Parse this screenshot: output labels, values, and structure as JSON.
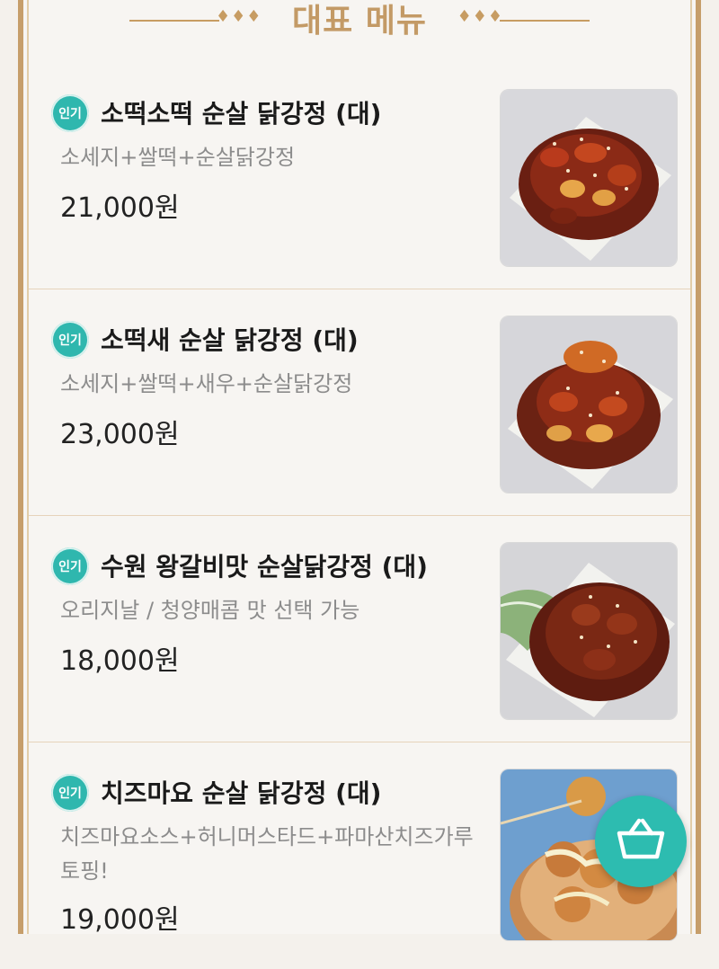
{
  "header": {
    "title": "대표 메뉴",
    "ornament": "♦♦♦"
  },
  "items": [
    {
      "badge": "인기",
      "name": "소떡소떡 순살 닭강정 (대)",
      "desc": "소세지+쌀떡+순살닭강정",
      "price": "21,000원",
      "image": "chicken-tteok-sausage"
    },
    {
      "badge": "인기",
      "name": "소떡새 순살 닭강정 (대)",
      "desc": "소세지+쌀떡+새우+순살닭강정",
      "price": "23,000원",
      "image": "chicken-shrimp-tteok"
    },
    {
      "badge": "인기",
      "name": "수원 왕갈비맛 순살닭강정 (대)",
      "desc": "오리지날 / 청양매콤 맛 선택 가능",
      "price": "18,000원",
      "image": "galbi-chicken"
    },
    {
      "badge": "인기",
      "name": "치즈마요 순살 닭강정 (대)",
      "desc": "치즈마요소스+허니머스타드+파마산치즈가루 토핑!",
      "price": "19,000원",
      "image": "cheese-mayo-chicken"
    }
  ],
  "cart": {
    "icon": "basket-icon"
  },
  "colors": {
    "accent": "#c39a66",
    "badge": "#2fb7ae",
    "cart": "#2dbcb0"
  }
}
